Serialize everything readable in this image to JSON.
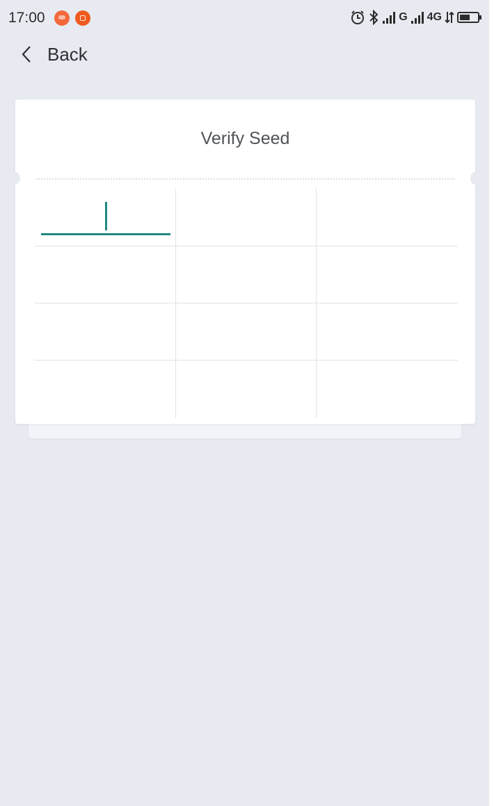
{
  "status_bar": {
    "time": "17:00",
    "network_1": "G",
    "network_2": "4G",
    "icons": [
      "notification-app-icon",
      "notification-app-icon",
      "alarm-icon",
      "bluetooth-icon",
      "signal-icon",
      "signal-icon",
      "data-arrows-icon",
      "battery-icon"
    ]
  },
  "nav": {
    "back_label": "Back"
  },
  "card": {
    "title": "Verify Seed",
    "cells": [
      "",
      "",
      "",
      "",
      "",
      "",
      "",
      "",
      "",
      "",
      "",
      ""
    ]
  },
  "colors": {
    "background": "#e7ebf1",
    "card": "#ffffff",
    "accent": "#1f8a80",
    "grid_line": "#e1e3e6"
  }
}
